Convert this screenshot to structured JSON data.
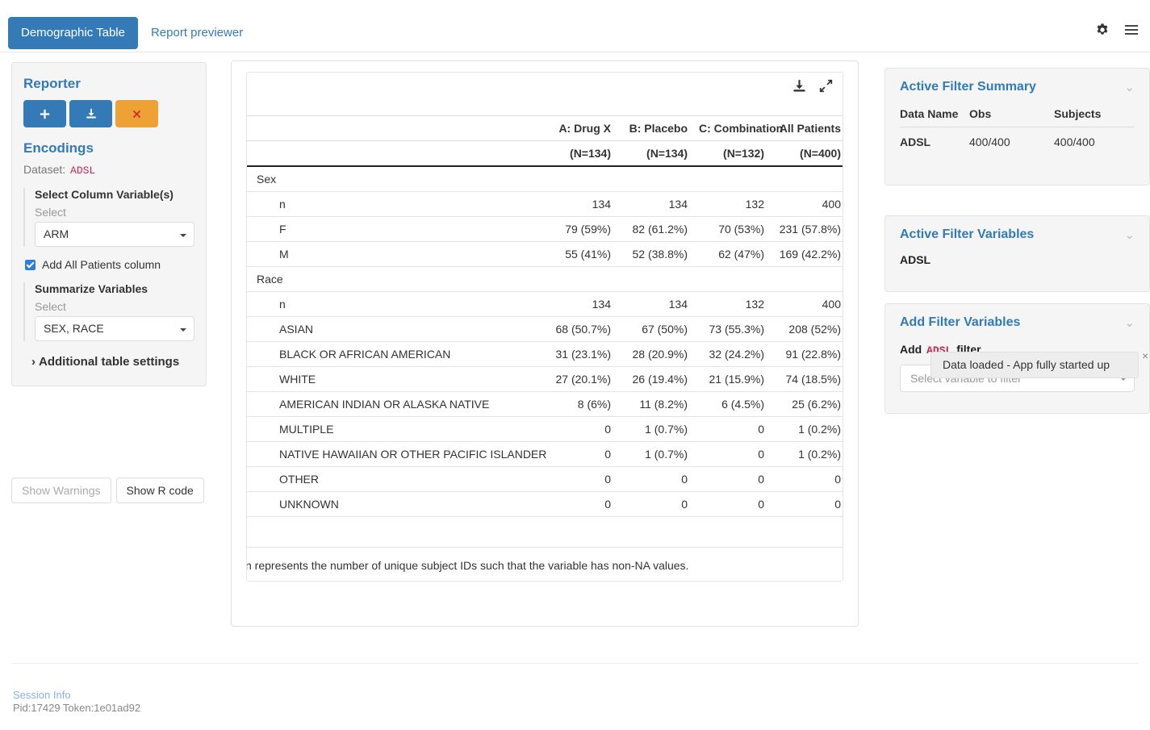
{
  "topnav": {
    "tabs": [
      {
        "label": "Demographic Table",
        "active": true
      },
      {
        "label": "Report previewer",
        "active": false
      }
    ],
    "icons": [
      {
        "name": "gear-icon"
      },
      {
        "name": "hamburger-menu-icon"
      }
    ]
  },
  "sidebar": {
    "reporter_title": "Reporter",
    "buttons": [
      {
        "name": "add-card-button",
        "glyph": "+"
      },
      {
        "name": "download-report-button",
        "glyph": "download"
      },
      {
        "name": "reset-report-button",
        "glyph": "×"
      }
    ],
    "encodings_title": "Encodings",
    "dataset_label": "Dataset:",
    "dataset_value": "ADSL",
    "column_block": {
      "title": "Select Column Variable(s)",
      "sublabel": "Select",
      "value": "ARM"
    },
    "checkbox": {
      "label": "Add All Patients column",
      "checked": true
    },
    "summarize_block": {
      "title": "Summarize Variables",
      "sublabel": "Select",
      "value": "SEX, RACE"
    },
    "additional_settings": "Additional table settings",
    "show_warnings": "Show Warnings",
    "show_r_code": "Show R code"
  },
  "table_card": {
    "icons": [
      {
        "name": "download-table-icon"
      },
      {
        "name": "expand-table-icon"
      }
    ],
    "columns": [
      "",
      "A: Drug X",
      "B: Placebo",
      "C: Combination",
      "All Patients"
    ],
    "subheaders": [
      "",
      "(N=134)",
      "(N=134)",
      "(N=132)",
      "(N=400)"
    ],
    "rows": [
      {
        "label": "Sex",
        "indent": false,
        "values": [
          "",
          "",
          "",
          ""
        ]
      },
      {
        "label": "n",
        "indent": true,
        "values": [
          "134",
          "134",
          "132",
          "400"
        ]
      },
      {
        "label": "F",
        "indent": true,
        "values": [
          "79 (59%)",
          "82 (61.2%)",
          "70 (53%)",
          "231 (57.8%)"
        ]
      },
      {
        "label": "M",
        "indent": true,
        "values": [
          "55 (41%)",
          "52 (38.8%)",
          "62 (47%)",
          "169 (42.2%)"
        ]
      },
      {
        "label": "Race",
        "indent": false,
        "values": [
          "",
          "",
          "",
          ""
        ]
      },
      {
        "label": "n",
        "indent": true,
        "values": [
          "134",
          "134",
          "132",
          "400"
        ]
      },
      {
        "label": "ASIAN",
        "indent": true,
        "values": [
          "68 (50.7%)",
          "67 (50%)",
          "73 (55.3%)",
          "208 (52%)"
        ]
      },
      {
        "label": "BLACK OR AFRICAN AMERICAN",
        "indent": true,
        "values": [
          "31 (23.1%)",
          "28 (20.9%)",
          "32 (24.2%)",
          "91 (22.8%)"
        ]
      },
      {
        "label": "WHITE",
        "indent": true,
        "values": [
          "27 (20.1%)",
          "26 (19.4%)",
          "21 (15.9%)",
          "74 (18.5%)"
        ]
      },
      {
        "label": "AMERICAN INDIAN OR ALASKA NATIVE",
        "indent": true,
        "values": [
          "8 (6%)",
          "11 (8.2%)",
          "6 (4.5%)",
          "25 (6.2%)"
        ]
      },
      {
        "label": "MULTIPLE",
        "indent": true,
        "values": [
          "0",
          "1 (0.7%)",
          "0",
          "1 (0.2%)"
        ]
      },
      {
        "label": "NATIVE HAWAIIAN OR OTHER PACIFIC ISLANDER",
        "indent": true,
        "values": [
          "0",
          "1 (0.7%)",
          "0",
          "1 (0.2%)"
        ]
      },
      {
        "label": "OTHER",
        "indent": true,
        "values": [
          "0",
          "0",
          "0",
          "0"
        ]
      },
      {
        "label": "UNKNOWN",
        "indent": true,
        "values": [
          "0",
          "0",
          "0",
          "0"
        ]
      }
    ],
    "footnote": "n represents the number of unique subject IDs such that the variable has non-NA values."
  },
  "right": {
    "summary_panel": {
      "title": "Active Filter Summary",
      "headers": [
        "Data Name",
        "Obs",
        "Subjects"
      ],
      "rows": [
        {
          "data_name": "ADSL",
          "obs": "400/400",
          "subjects": "400/400"
        }
      ]
    },
    "active_vars_panel": {
      "title": "Active Filter Variables",
      "items": [
        "ADSL"
      ]
    },
    "add_vars_panel": {
      "title": "Add Filter Variables",
      "add_prefix": "Add",
      "dataset": "ADSL",
      "add_suffix": "filter",
      "select_placeholder": "Select variable to filter"
    }
  },
  "toast": {
    "message": "Data loaded - App fully started up",
    "close_glyph": "×"
  },
  "footer": {
    "session_link": "Session Info",
    "session_meta": "Pid:17429 Token:1e01ad92"
  },
  "colors": {
    "primary": "#337ab7",
    "warning": "#eea236",
    "danger": "#c9302c",
    "code": "#c7254e",
    "panel_bg": "#f5f5f5"
  }
}
